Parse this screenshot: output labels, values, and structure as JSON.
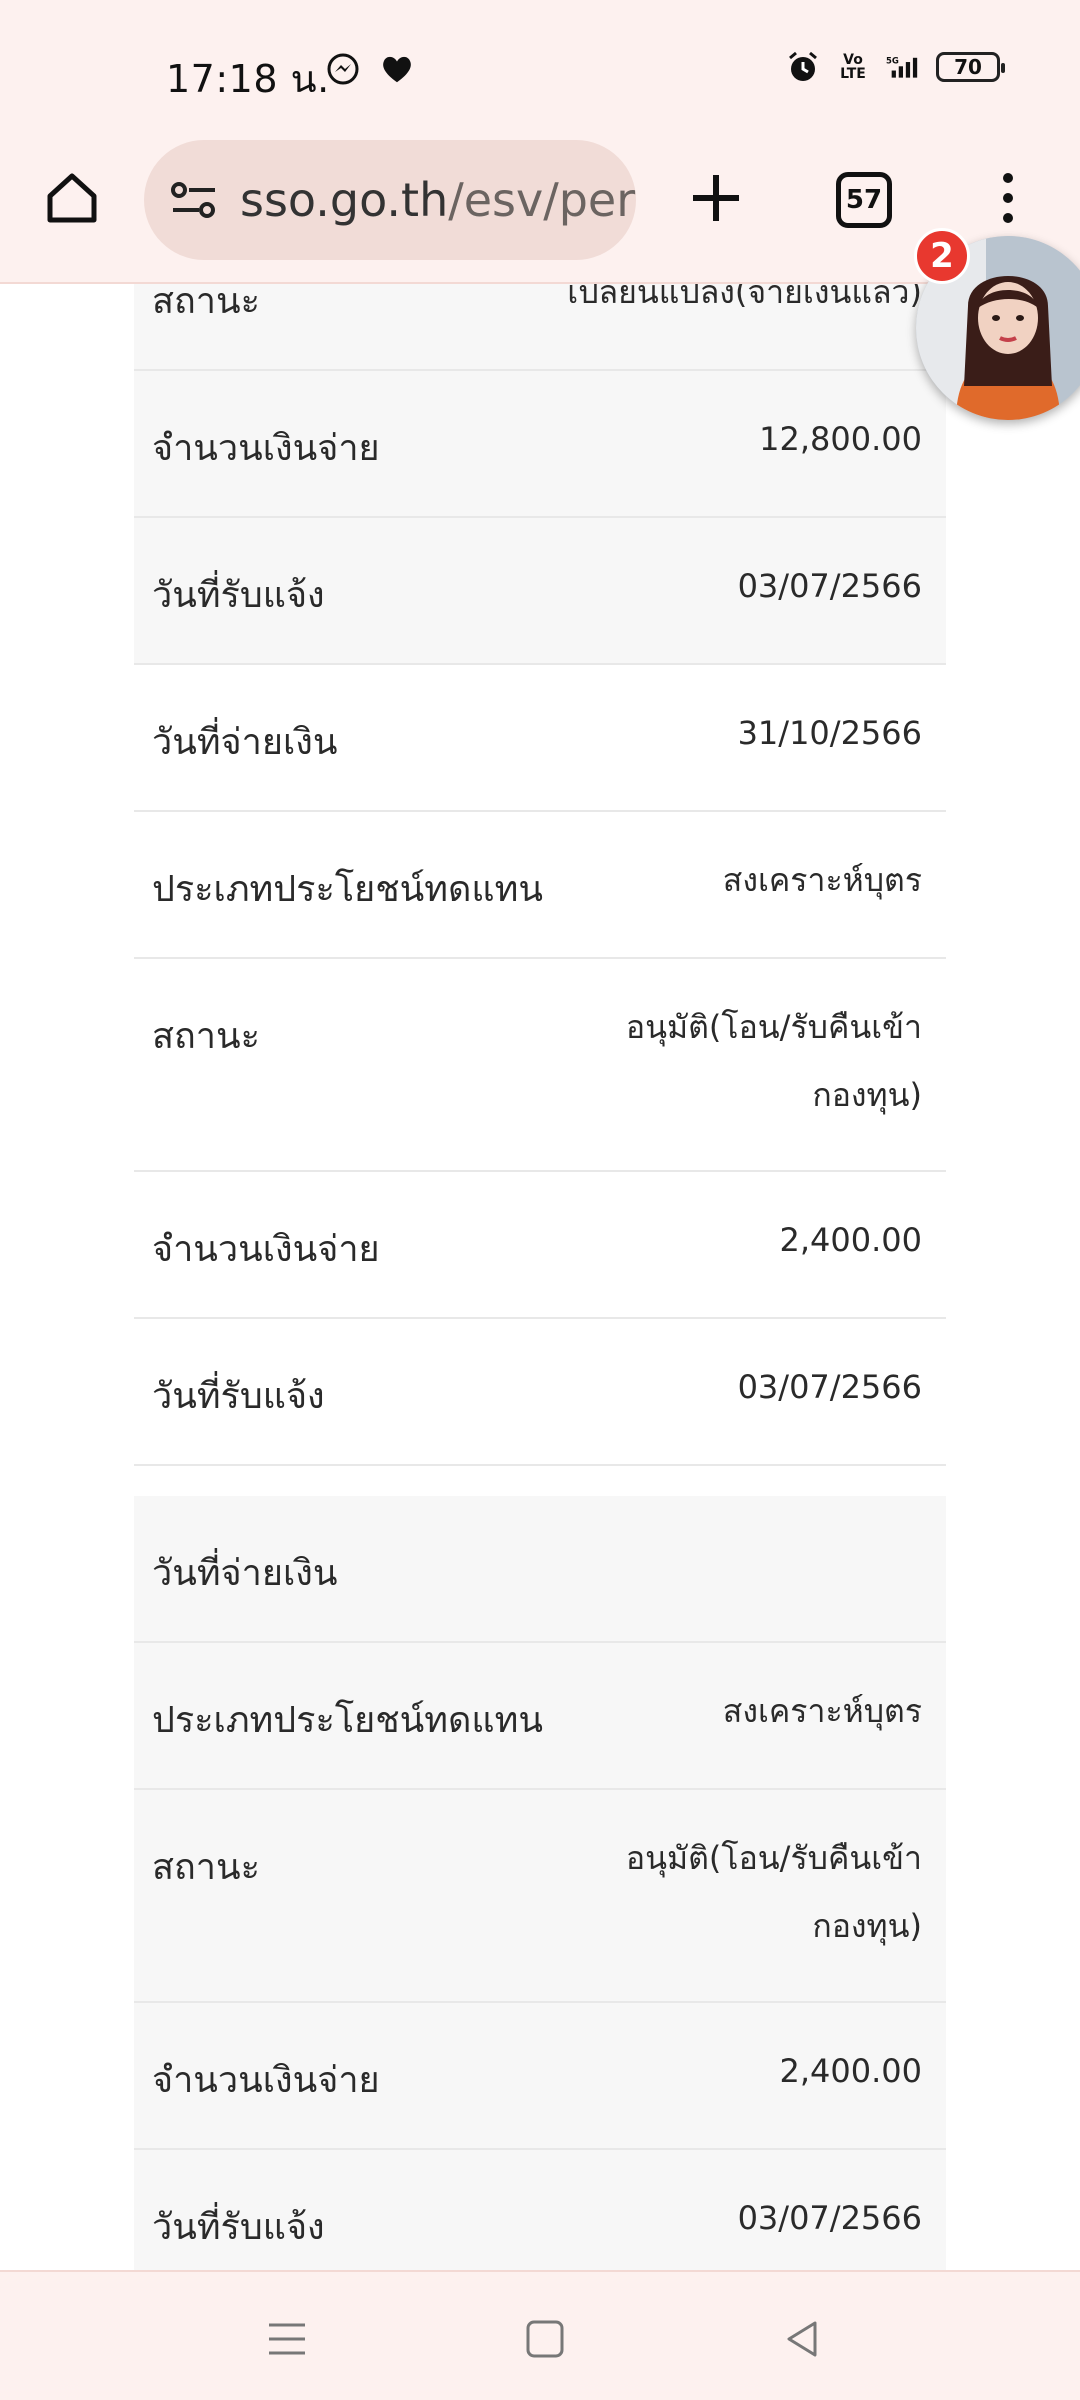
{
  "status_bar": {
    "time": "17:18 น.",
    "battery": "70",
    "network": "5G",
    "volte": "Vo LTE"
  },
  "browser": {
    "url_domain": "sso.go.th",
    "url_path": "/esv/per",
    "tab_count": "57"
  },
  "chat_head": {
    "badge_count": "2"
  },
  "rows": [
    {
      "label": "สถานะ",
      "value": "เปลี่ยนแปลง(จ่ายเงินแล้ว)"
    },
    {
      "label": "จำนวนเงินจ่าย",
      "value": "12,800.00"
    },
    {
      "label": "วันที่รับแจ้ง",
      "value": "03/07/2566"
    },
    {
      "label": "วันที่จ่ายเงิน",
      "value": "31/10/2566"
    },
    {
      "label": "ประเภทประโยชน์ทดแทน",
      "value": "สงเคราะห์บุตร"
    },
    {
      "label": "สถานะ",
      "value": "อนุมัติ(โอน/รับคืนเข้ากองทุน)"
    },
    {
      "label": "จำนวนเงินจ่าย",
      "value": "2,400.00"
    },
    {
      "label": "วันที่รับแจ้ง",
      "value": "03/07/2566"
    },
    {
      "label": "วันที่จ่ายเงิน",
      "value": ""
    },
    {
      "label": "ประเภทประโยชน์ทดแทน",
      "value": "สงเคราะห์บุตร"
    },
    {
      "label": "สถานะ",
      "value": "อนุมัติ(โอน/รับคืนเข้ากองทุน)"
    },
    {
      "label": "จำนวนเงินจ่าย",
      "value": "2,400.00"
    },
    {
      "label": "วันที่รับแจ้ง",
      "value": "03/07/2566"
    }
  ],
  "icons": {
    "home": "home-icon",
    "site_info": "tune-icon",
    "new_tab": "plus-icon",
    "menu": "more-vert-icon",
    "nav_recents": "menu-lines-icon",
    "nav_home": "square-icon",
    "nav_back": "triangle-back-icon"
  },
  "colors": {
    "chrome_bg": "#fdf1ef",
    "omnibox_bg": "#f1dcd7",
    "badge": "#e8382f",
    "row_alt": "#f7f7f7"
  }
}
